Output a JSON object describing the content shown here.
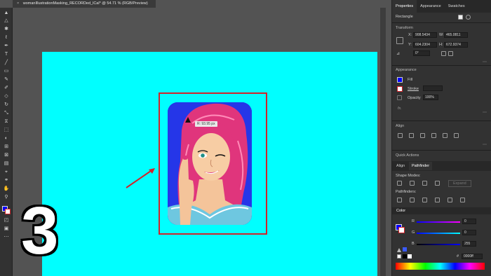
{
  "document_tab": {
    "close": "×",
    "title": "womanIllustrationMasking_RECORDed_lCal* @ 54.71 % (RGB/Preview)"
  },
  "canvas": {
    "tooltip": "R: 93.95 px",
    "step_number": "3"
  },
  "panel": {
    "tabs": [
      "Properties",
      "Appearance",
      "Swatches"
    ],
    "object_type": "Rectangle",
    "transform": {
      "title": "Transform",
      "x_label": "X:",
      "x_value": "908.5434",
      "y_label": "Y:",
      "y_value": "604.2304",
      "w_label": "W:",
      "w_value": "465.0811",
      "h_label": "H:",
      "h_value": "672.9374",
      "angle_value": "0°"
    },
    "appearance": {
      "title": "Appearance",
      "fill_label": "Fill",
      "stroke_label": "Stroke",
      "opacity_label": "Opacity",
      "opacity_value": "100%",
      "fx_label": "fx."
    },
    "align": {
      "title": "Align"
    },
    "quick_actions": {
      "title": "Quick Actions"
    },
    "pathfinder_tabs": [
      "Align",
      "Pathfinder"
    ],
    "shape_modes_label": "Shape Modes:",
    "expand_label": "Expand",
    "pathfinders_label": "Pathfinders:",
    "color": {
      "title": "Color",
      "r_label": "R",
      "r_value": "0",
      "g_label": "G",
      "g_value": "0",
      "b_label": "B",
      "b_value": "255",
      "hex_label": "#",
      "hex_value": "0000ff"
    }
  },
  "colors": {
    "artboard": "#00ffff",
    "selection": "#d2232a",
    "fill": "#0000ff"
  }
}
